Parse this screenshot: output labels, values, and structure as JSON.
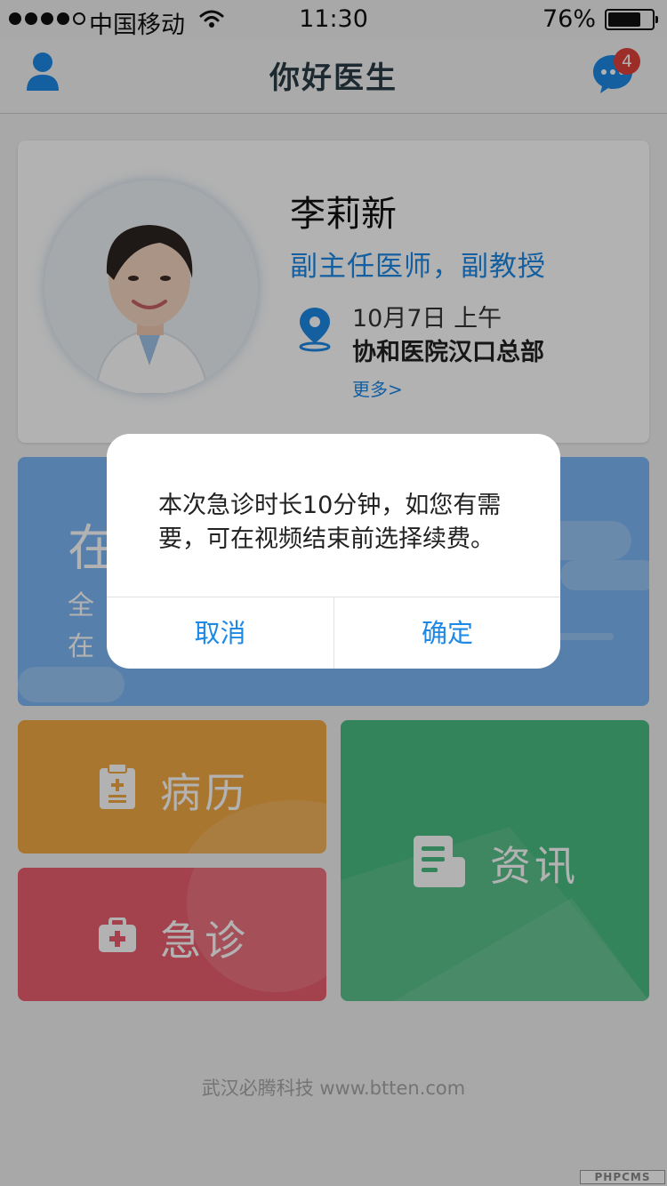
{
  "status_bar": {
    "carrier": "中国移动",
    "time": "11:30",
    "battery_text": "76%",
    "battery_level": 0.76
  },
  "nav": {
    "title": "你好医生",
    "message_badge": "4",
    "user_icon": "user-icon",
    "message_icon": "chat-bubble-icon"
  },
  "doctor": {
    "name": "李莉新",
    "title": "副主任医师，副教授",
    "date": "10月7日 上午",
    "hospital": "协和医院汉口总部",
    "more": "更多>"
  },
  "online": {
    "title": "在",
    "sub1": "全",
    "sub2": "在"
  },
  "tiles": {
    "records": {
      "label": "病历",
      "icon": "clipboard-icon"
    },
    "emergency": {
      "label": "急诊",
      "icon": "medical-kit-icon"
    },
    "news": {
      "label": "资讯",
      "icon": "document-icon"
    }
  },
  "footer": "武汉必腾科技 www.btten.com",
  "watermark": "PHPCMS",
  "dialog": {
    "message": "本次急诊时长10分钟，如您有需要，可在视频结束前选择续费。",
    "cancel": "取消",
    "confirm": "确定"
  },
  "colors": {
    "accent": "#1e88e5",
    "records": "#f2aa45",
    "emergency": "#ea5f6f",
    "news": "#4bbd83",
    "online": "#7cb6f5",
    "badge": "#e0413b"
  }
}
